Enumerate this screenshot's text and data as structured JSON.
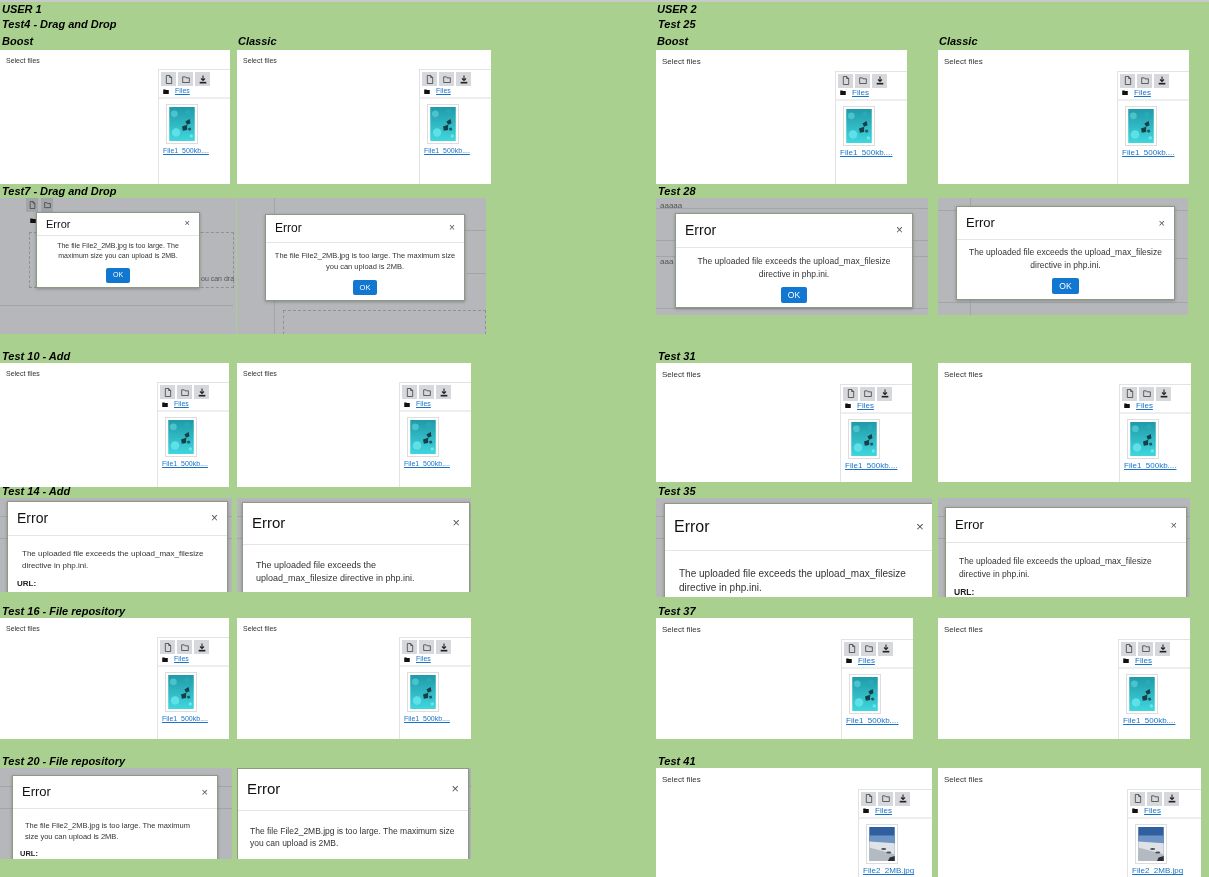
{
  "users": [
    {
      "title": "USER 1",
      "tests": [
        {
          "title": "Test4 - Drag and Drop",
          "themes": [
            "Boost",
            "Classic"
          ],
          "panels": [
            {
              "kind": "filepicker",
              "label": "Select files",
              "folder": "Files",
              "file": {
                "name": "File1_500kb....",
                "kind": "picture"
              }
            },
            {
              "kind": "filepicker",
              "label": "Select files",
              "folder": "Files",
              "file": {
                "name": "File1_500kb....",
                "kind": "picture"
              }
            }
          ]
        },
        {
          "title": "Test7 - Drag and Drop",
          "panels": [
            {
              "kind": "error",
              "title": "Error",
              "close": "×",
              "message": "The file File2_2MB.jpg is too large. The maximum size you can upload is 2MB.",
              "button": "OK",
              "backdrop_texts": [
                "ou can dra"
              ]
            },
            {
              "kind": "error",
              "title": "Error",
              "close": "×",
              "message": "The file File2_2MB.jpg is too large. The maximum size you can upload is 2MB.",
              "button": "OK"
            }
          ]
        },
        {
          "title": "Test 10 - Add",
          "panels": [
            {
              "kind": "filepicker",
              "label": "Select files",
              "folder": "Files",
              "file": {
                "name": "File1_500kb....",
                "kind": "picture"
              }
            },
            {
              "kind": "filepicker",
              "label": "Select files",
              "folder": "Files",
              "file": {
                "name": "File1_500kb....",
                "kind": "picture"
              }
            }
          ]
        },
        {
          "title": "Test 14 - Add",
          "panels": [
            {
              "kind": "error",
              "title": "Error",
              "close": "×",
              "message": "The uploaded file exceeds the upload_max_filesize directive in php.ini.",
              "field_label": "URL:"
            },
            {
              "kind": "error",
              "title": "Error",
              "close": "×",
              "message": "The uploaded file exceeds the upload_max_filesize directive in php.ini."
            }
          ]
        },
        {
          "title": "Test 16 - File repository",
          "panels": [
            {
              "kind": "filepicker",
              "label": "Select files",
              "folder": "Files",
              "file": {
                "name": "File1_500kb....",
                "kind": "picture"
              }
            },
            {
              "kind": "filepicker",
              "label": "Select files",
              "folder": "Files",
              "file": {
                "name": "File1_500kb....",
                "kind": "picture"
              }
            }
          ]
        },
        {
          "title": "Test 20 - File repository",
          "panels": [
            {
              "kind": "error",
              "title": "Error",
              "close": "×",
              "message": "The file File2_2MB.jpg is too large. The maximum size you can upload is 2MB.",
              "field_label": "URL:"
            },
            {
              "kind": "error",
              "title": "Error",
              "close": "×",
              "message": "The file File2_2MB.jpg is too large. The maximum size you can upload is 2MB."
            }
          ]
        }
      ]
    },
    {
      "title": "USER 2",
      "tests": [
        {
          "title": "Test 25",
          "themes": [
            "Boost",
            "Classic"
          ],
          "panels": [
            {
              "kind": "filepicker",
              "label": "Select files",
              "folder": "Files",
              "file": {
                "name": "File1_500kb....",
                "kind": "picture"
              }
            },
            {
              "kind": "filepicker",
              "label": "Select files",
              "folder": "Files",
              "file": {
                "name": "File1_500kb....",
                "kind": "picture"
              }
            }
          ]
        },
        {
          "title": "Test 28",
          "panels": [
            {
              "kind": "error",
              "title": "Error",
              "close": "×",
              "message": "The uploaded file exceeds the upload_max_filesize directive in php.ini.",
              "button": "OK",
              "backdrop_texts": [
                "aaaaa",
                "aaa"
              ]
            },
            {
              "kind": "error",
              "title": "Error",
              "close": "×",
              "message": "The uploaded file exceeds the upload_max_filesize directive in php.ini.",
              "button": "OK"
            }
          ]
        },
        {
          "title": "Test 31",
          "panels": [
            {
              "kind": "filepicker",
              "label": "Select files",
              "folder": "Files",
              "file": {
                "name": "File1_500kb....",
                "kind": "picture"
              }
            },
            {
              "kind": "filepicker",
              "label": "Select files",
              "folder": "Files",
              "file": {
                "name": "File1_500kb....",
                "kind": "picture"
              }
            }
          ]
        },
        {
          "title": "Test 35",
          "panels": [
            {
              "kind": "error",
              "title": "Error",
              "close": "×",
              "message": "The uploaded file exceeds the upload_max_filesize directive in php.ini."
            },
            {
              "kind": "error",
              "title": "Error",
              "close": "×",
              "message": "The uploaded file exceeds the upload_max_filesize directive in php.ini.",
              "field_label": "URL:"
            }
          ]
        },
        {
          "title": "Test 37",
          "panels": [
            {
              "kind": "filepicker",
              "label": "Select files",
              "folder": "Files",
              "file": {
                "name": "File1_500kb....",
                "kind": "picture"
              }
            },
            {
              "kind": "filepicker",
              "label": "Select files",
              "folder": "Files",
              "file": {
                "name": "File1_500kb....",
                "kind": "picture"
              }
            }
          ]
        },
        {
          "title": "Test 41",
          "panels": [
            {
              "kind": "filepicker",
              "label": "Select files",
              "folder": "Files",
              "file": {
                "name": "File2_2MB.jpg",
                "kind": "picture"
              }
            },
            {
              "kind": "filepicker",
              "label": "Select files",
              "folder": "Files",
              "file": {
                "name": "File2_2MB.jpg",
                "kind": "picture"
              }
            }
          ]
        }
      ]
    }
  ]
}
